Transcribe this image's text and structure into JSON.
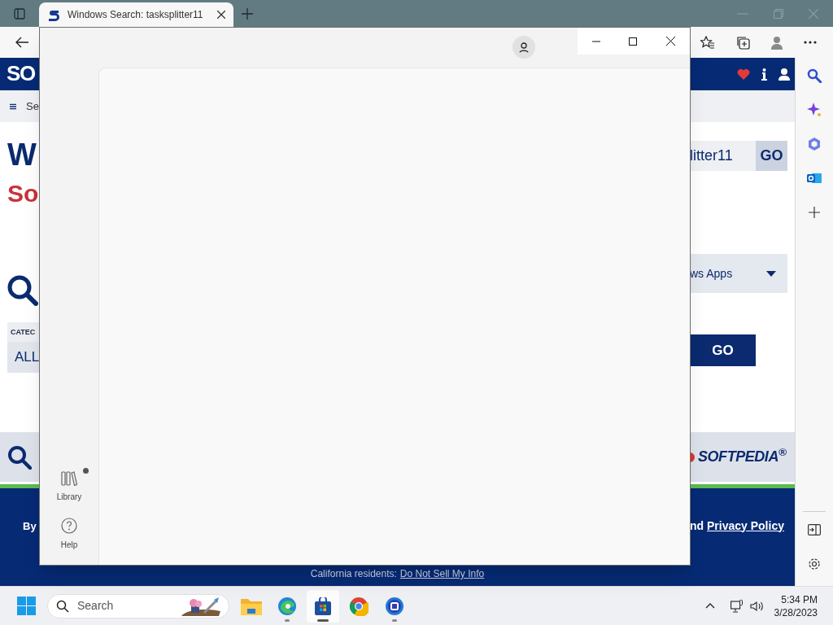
{
  "browser": {
    "tabs": [
      {
        "title": "Windows Search: tasksplitter11",
        "selected": true
      }
    ],
    "page": {
      "logo": "SO",
      "menu_label": "Se",
      "heading": "W",
      "subheading": "So",
      "search_value": "litter11",
      "search_button": "GO",
      "category_label": "CATEC",
      "category_value": "ALL",
      "platform_value": "ws Apps",
      "go_button": "GO",
      "footer_brand": "SOFTPEDIA$^{®}$",
      "footer_left": "By",
      "footer_text": "nd",
      "footer_link": "Privacy Policy",
      "california": "California residents:",
      "california_link": "Do Not Sell My Info"
    }
  },
  "app_window": {
    "nav": [
      {
        "label": "Library",
        "badge": true
      },
      {
        "label": "Help",
        "badge": false
      }
    ]
  },
  "taskbar": {
    "search_placeholder": "Search",
    "apps": [
      {
        "kind": "files",
        "running": false,
        "selected": false
      },
      {
        "kind": "edge",
        "running": true,
        "selected": false
      },
      {
        "kind": "store",
        "running": true,
        "selected": true
      },
      {
        "kind": "chrome",
        "running": false,
        "selected": false
      },
      {
        "kind": "app",
        "running": true,
        "selected": false
      }
    ],
    "time": "5:34 PM",
    "date": "3/28/2023"
  }
}
